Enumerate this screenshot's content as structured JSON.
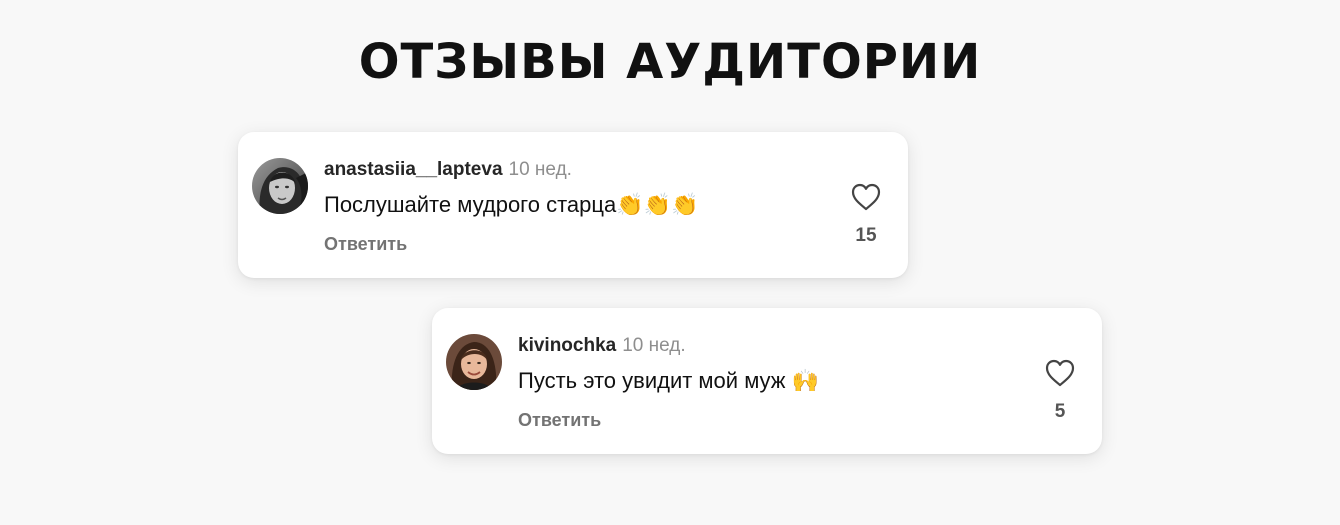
{
  "page": {
    "title": "ОТЗЫВЫ АУДИТОРИИ"
  },
  "comments": [
    {
      "username": "anastasiia__lapteva",
      "time": "10 нед.",
      "text": "Послушайте мудрого старца👏👏👏",
      "reply_label": "Ответить",
      "likes": "15",
      "avatar_icon": "avatar-woman-portrait-icon"
    },
    {
      "username": "kivinochka",
      "time": "10 нед.",
      "text": "Пусть это увидит мой муж 🙌",
      "reply_label": "Ответить",
      "likes": "5",
      "avatar_icon": "avatar-woman-photo-icon"
    }
  ],
  "colors": {
    "background": "#f8f8f8",
    "card": "#ffffff",
    "muted_text": "#8e8e8e",
    "reply_text": "#737373"
  }
}
